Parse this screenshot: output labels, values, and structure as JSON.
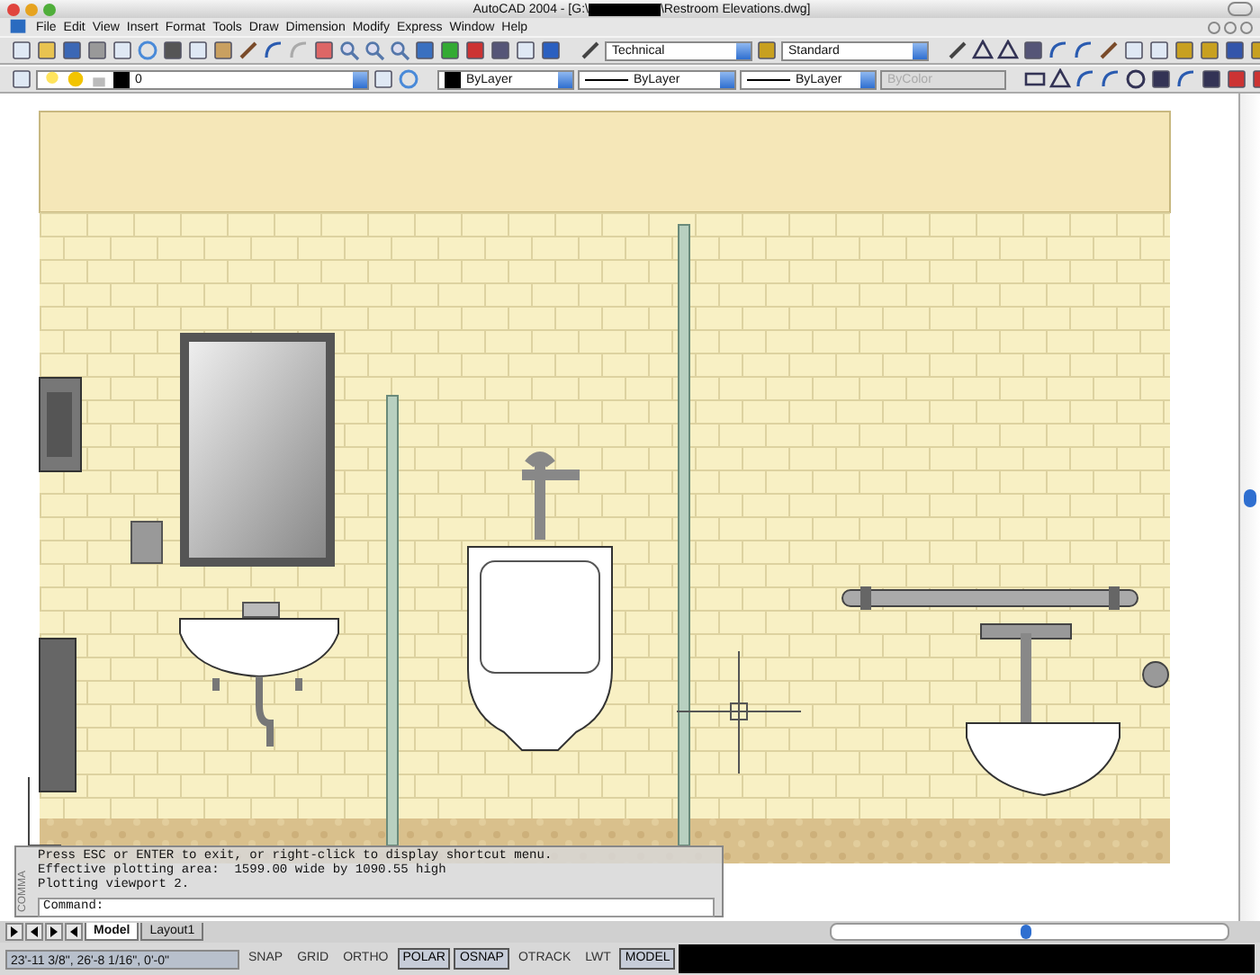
{
  "window": {
    "title_prefix": "AutoCAD 2004 - [G:\\",
    "title_suffix": "\\Restroom Elevations.dwg]"
  },
  "menu": [
    "File",
    "Edit",
    "View",
    "Insert",
    "Format",
    "Tools",
    "Draw",
    "Dimension",
    "Modify",
    "Express",
    "Window",
    "Help"
  ],
  "styles_toolbar": {
    "text_style": "Technical",
    "dim_style": "Standard"
  },
  "properties_toolbar": {
    "layer": "0",
    "color_setting": "ByLayer",
    "linetype": "ByLayer",
    "lineweight": "ByLayer",
    "plot_style": {
      "label": "ByColor",
      "disabled": true
    }
  },
  "command_window": {
    "side_label": "COMMA",
    "lines": [
      "Press ESC or ENTER to exit, or right-click to display shortcut menu.",
      "Effective plotting area:  1599.00 wide by 1090.55 high",
      "Plotting viewport 2."
    ],
    "prompt": "Command:"
  },
  "tabs": [
    {
      "label": "Model",
      "selected": true
    },
    {
      "label": "Layout1",
      "selected": false
    }
  ],
  "status_bar": {
    "coordinates": "23'-11 3/8\", 26'-8 1/16\", 0'-0\"",
    "toggles": [
      {
        "label": "SNAP",
        "on": false
      },
      {
        "label": "GRID",
        "on": false
      },
      {
        "label": "ORTHO",
        "on": false
      },
      {
        "label": "POLAR",
        "on": true
      },
      {
        "label": "OSNAP",
        "on": true
      },
      {
        "label": "OTRACK",
        "on": false
      },
      {
        "label": "LWT",
        "on": false
      },
      {
        "label": "MODEL",
        "on": true
      }
    ]
  }
}
